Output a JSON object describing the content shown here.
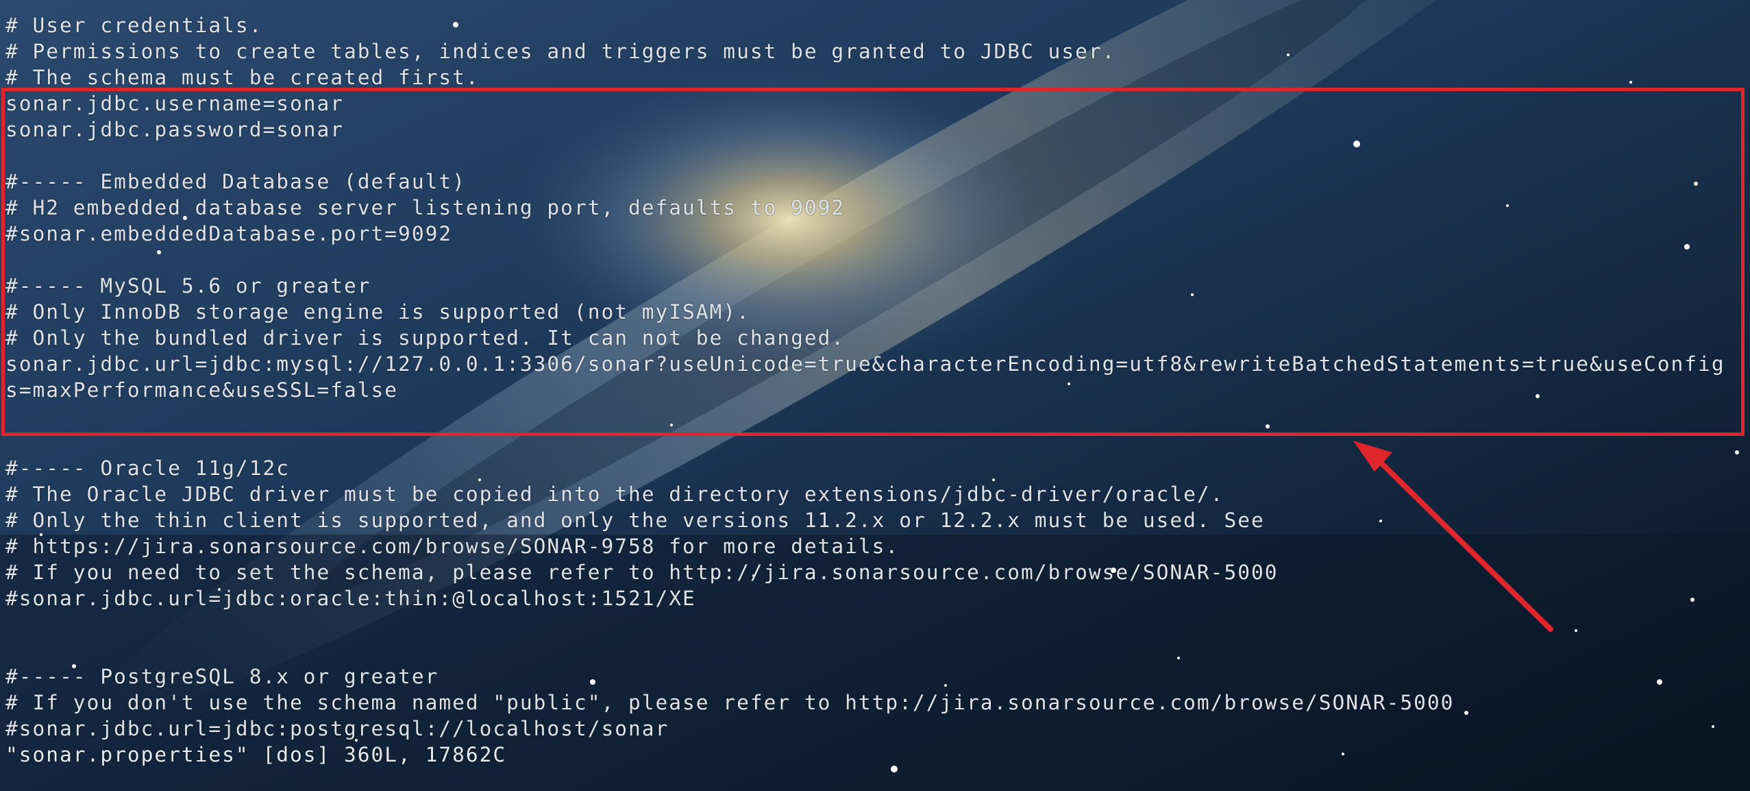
{
  "terminal": {
    "lines": [
      "# User credentials.",
      "# Permissions to create tables, indices and triggers must be granted to JDBC user.",
      "# The schema must be created first.",
      "sonar.jdbc.username=sonar",
      "sonar.jdbc.password=sonar",
      "",
      "#----- Embedded Database (default)",
      "# H2 embedded database server listening port, defaults to 9092",
      "#sonar.embeddedDatabase.port=9092",
      "",
      "#----- MySQL 5.6 or greater",
      "# Only InnoDB storage engine is supported (not myISAM).",
      "# Only the bundled driver is supported. It can not be changed.",
      "sonar.jdbc.url=jdbc:mysql://127.0.0.1:3306/sonar?useUnicode=true&characterEncoding=utf8&rewriteBatchedStatements=true&useConfig",
      "s=maxPerformance&useSSL=false",
      "",
      "",
      "#----- Oracle 11g/12c",
      "# The Oracle JDBC driver must be copied into the directory extensions/jdbc-driver/oracle/.",
      "# Only the thin client is supported, and only the versions 11.2.x or 12.2.x must be used. See",
      "# https://jira.sonarsource.com/browse/SONAR-9758 for more details.",
      "# If you need to set the schema, please refer to http://jira.sonarsource.com/browse/SONAR-5000",
      "#sonar.jdbc.url=jdbc:oracle:thin:@localhost:1521/XE",
      "",
      "",
      "#----- PostgreSQL 8.x or greater",
      "# If you don't use the schema named \"public\", please refer to http://jira.sonarsource.com/browse/SONAR-5000",
      "#sonar.jdbc.url=jdbc:postgresql://localhost/sonar"
    ],
    "status_line": "\"sonar.properties\" [dos] 360L, 17862C"
  },
  "colors": {
    "text": "#dfe3e8",
    "annotation": "#e0262b",
    "background": "#0c1a2c"
  },
  "icons": {
    "annotation_arrow": "arrow-up-left-icon"
  }
}
